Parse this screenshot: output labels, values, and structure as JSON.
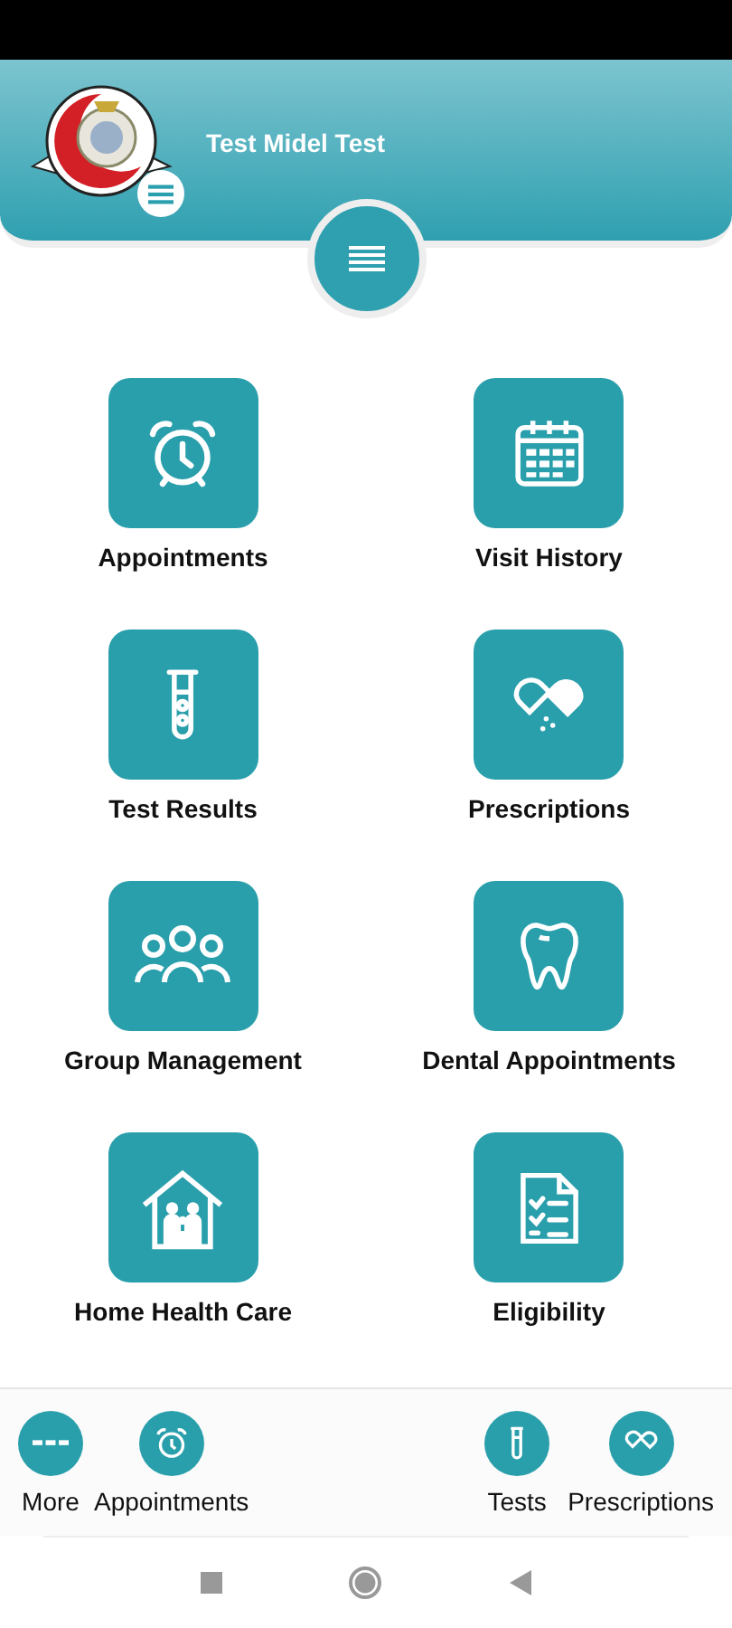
{
  "header": {
    "user_name": "Test Midel Test"
  },
  "tiles": [
    {
      "label": "Appointments"
    },
    {
      "label": "Visit History"
    },
    {
      "label": "Test Results"
    },
    {
      "label": "Prescriptions"
    },
    {
      "label": "Group Management"
    },
    {
      "label": "Dental Appointments"
    },
    {
      "label": "Home Health Care"
    },
    {
      "label": "Eligibility"
    }
  ],
  "bottom_nav": [
    {
      "label": "More"
    },
    {
      "label": "Appointments"
    },
    {
      "label": "Tests"
    },
    {
      "label": "Prescriptions"
    }
  ]
}
